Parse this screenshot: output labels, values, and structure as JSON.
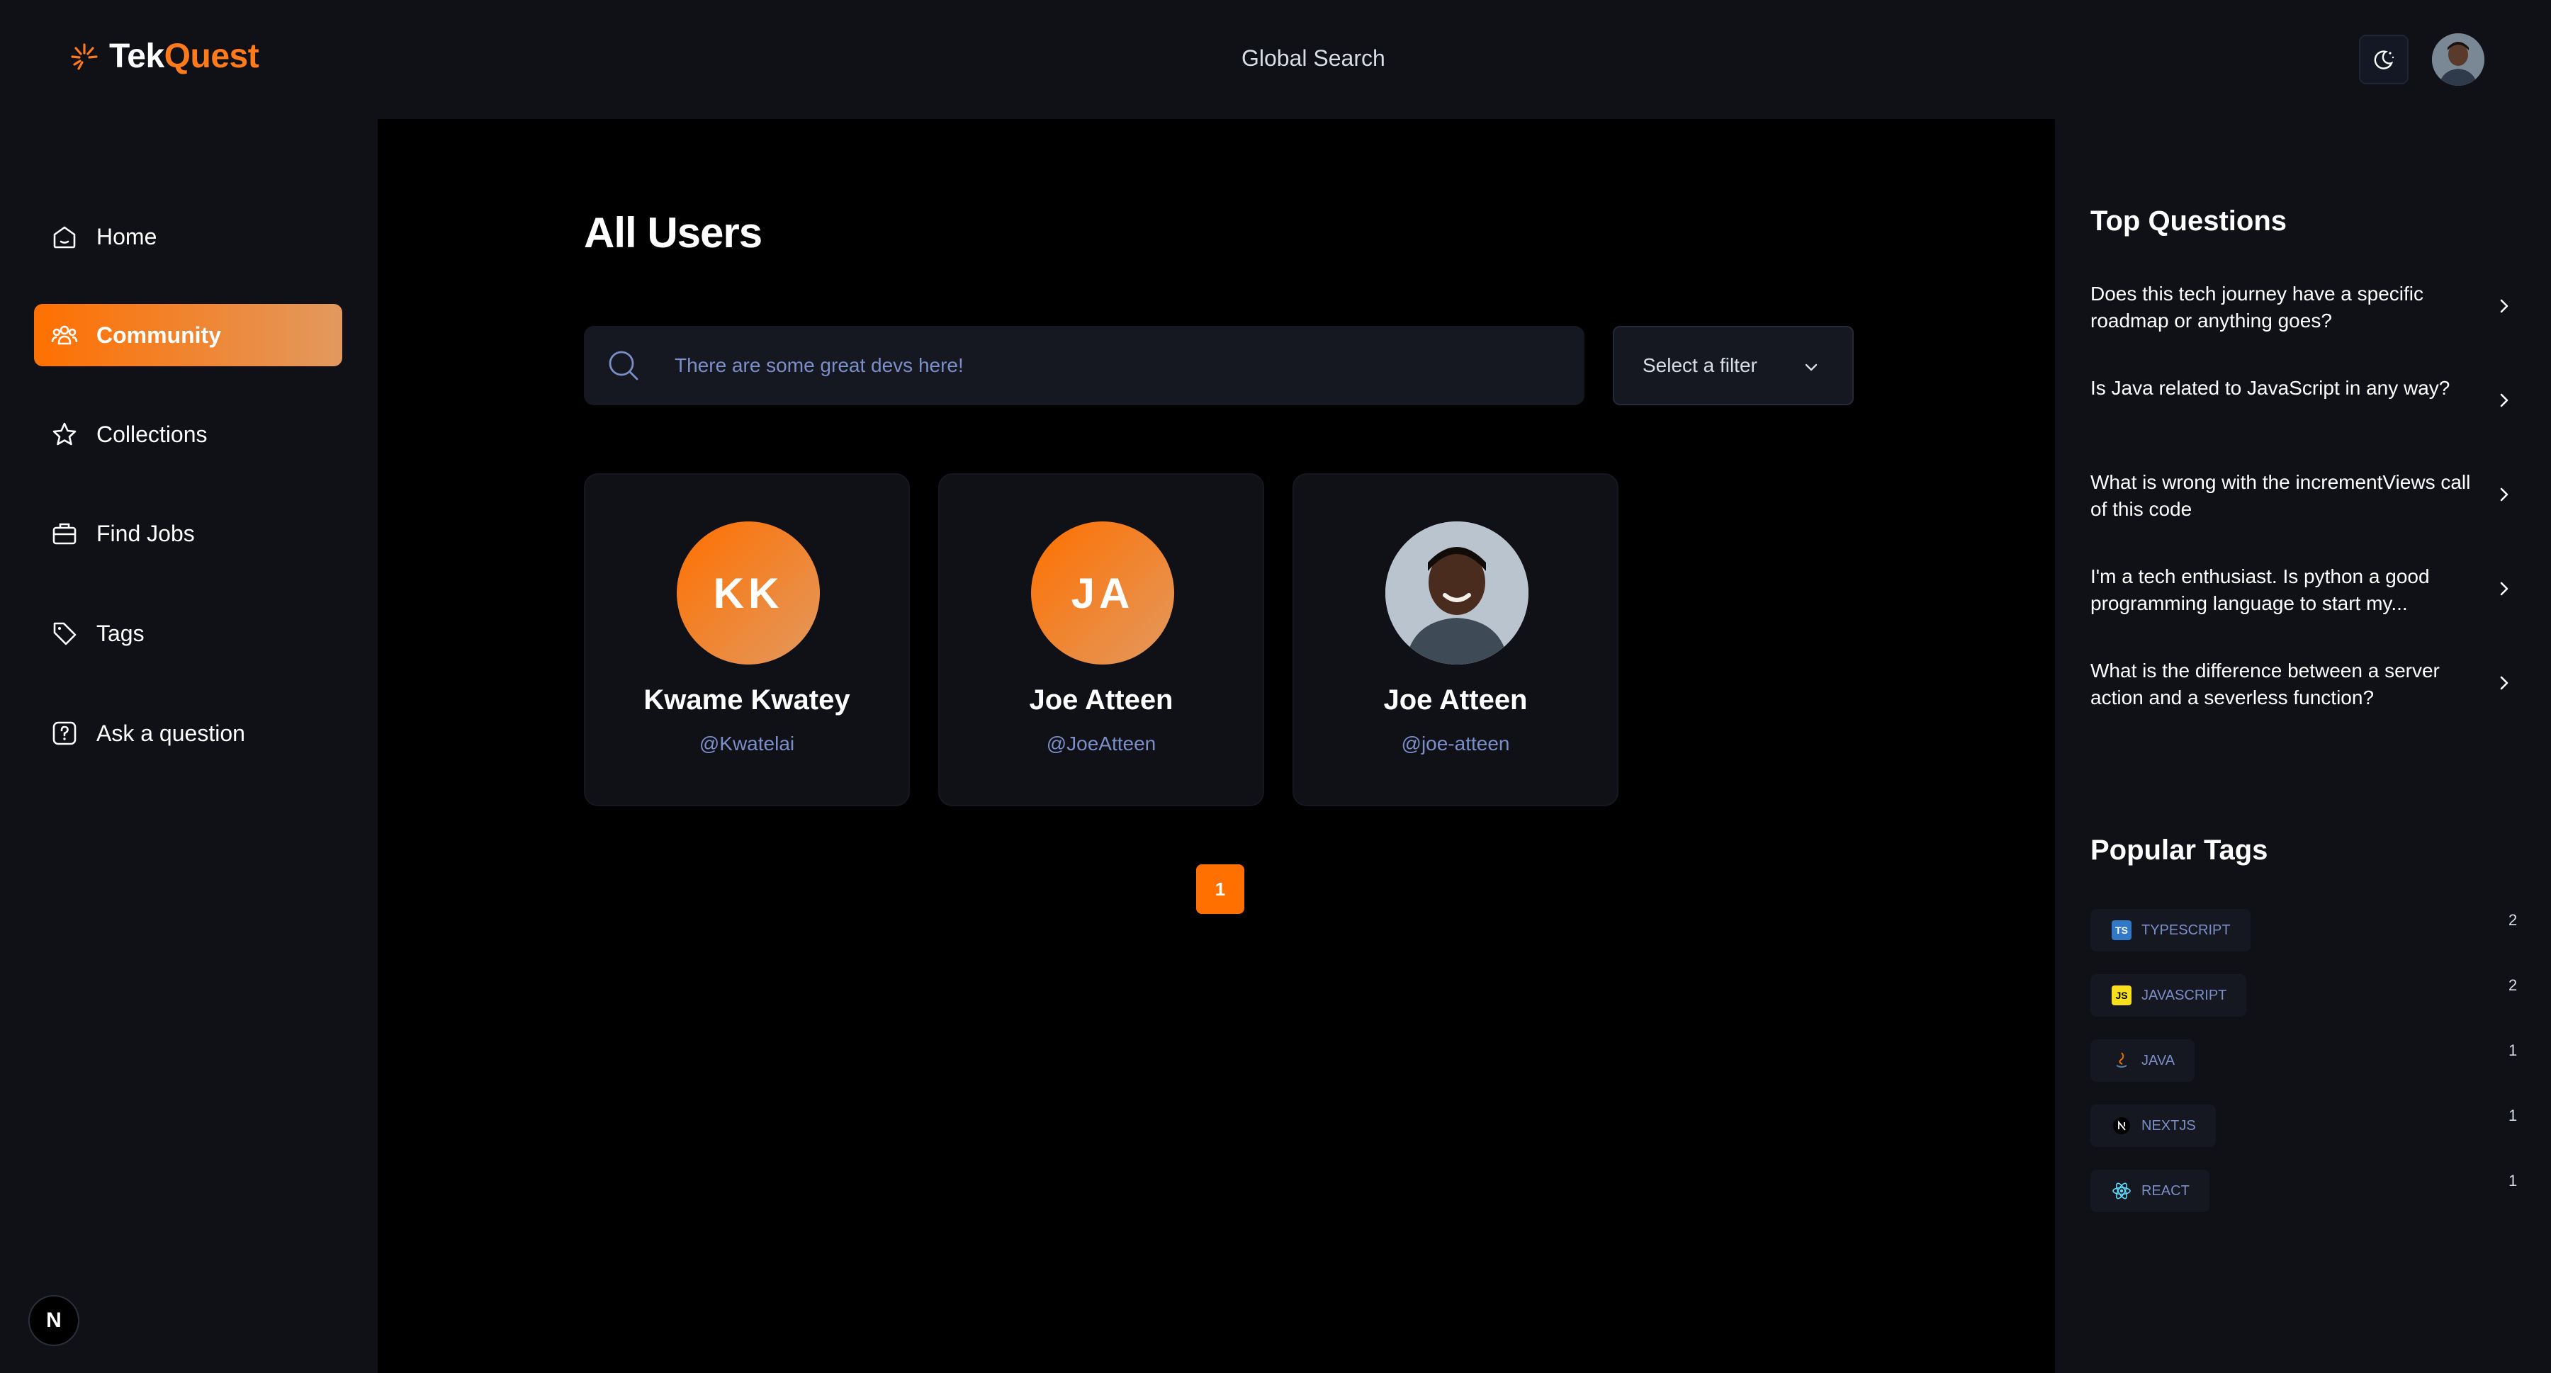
{
  "header": {
    "logo_tek": "Tek",
    "logo_quest": "Quest",
    "global_search": "Global Search"
  },
  "sidebar": {
    "items": [
      {
        "label": "Home",
        "icon": "home-icon"
      },
      {
        "label": "Community",
        "icon": "users-icon",
        "active": true
      },
      {
        "label": "Collections",
        "icon": "star-icon"
      },
      {
        "label": "Find Jobs",
        "icon": "briefcase-icon"
      },
      {
        "label": "Tags",
        "icon": "tag-icon"
      },
      {
        "label": "Ask a question",
        "icon": "question-icon"
      }
    ],
    "next_badge": "N"
  },
  "main": {
    "title": "All Users",
    "search_placeholder": "There are some great devs here!",
    "filter_label": "Select a filter",
    "users": [
      {
        "initials": "KK",
        "name": "Kwame Kwatey",
        "handle": "@Kwatelai"
      },
      {
        "initials": "JA",
        "name": "Joe Atteen",
        "handle": "@JoeAtteen"
      },
      {
        "initials": "",
        "name": "Joe Atteen",
        "handle": "@joe-atteen"
      }
    ],
    "current_page": "1"
  },
  "right_sidebar": {
    "top_questions_title": "Top Questions",
    "questions": [
      "Does this tech journey have a specific roadmap or anything goes?",
      "Is Java related to JavaScript in any way?",
      "What is wrong with the incrementViews call of this code",
      "I'm a tech enthusiast. Is python a good programming language to start my...",
      "What is the difference between a server action and a severless function?"
    ],
    "popular_tags_title": "Popular Tags",
    "tags": [
      {
        "name": "typescript",
        "count": "2"
      },
      {
        "name": "javascript",
        "count": "2"
      },
      {
        "name": "java",
        "count": "1"
      },
      {
        "name": "nextjs",
        "count": "1"
      },
      {
        "name": "react",
        "count": "1"
      }
    ]
  },
  "colors": {
    "accent": "#ff7000",
    "accent_light": "#e2995f",
    "panel": "#0f1117",
    "muted_text": "#7b8ec8"
  }
}
